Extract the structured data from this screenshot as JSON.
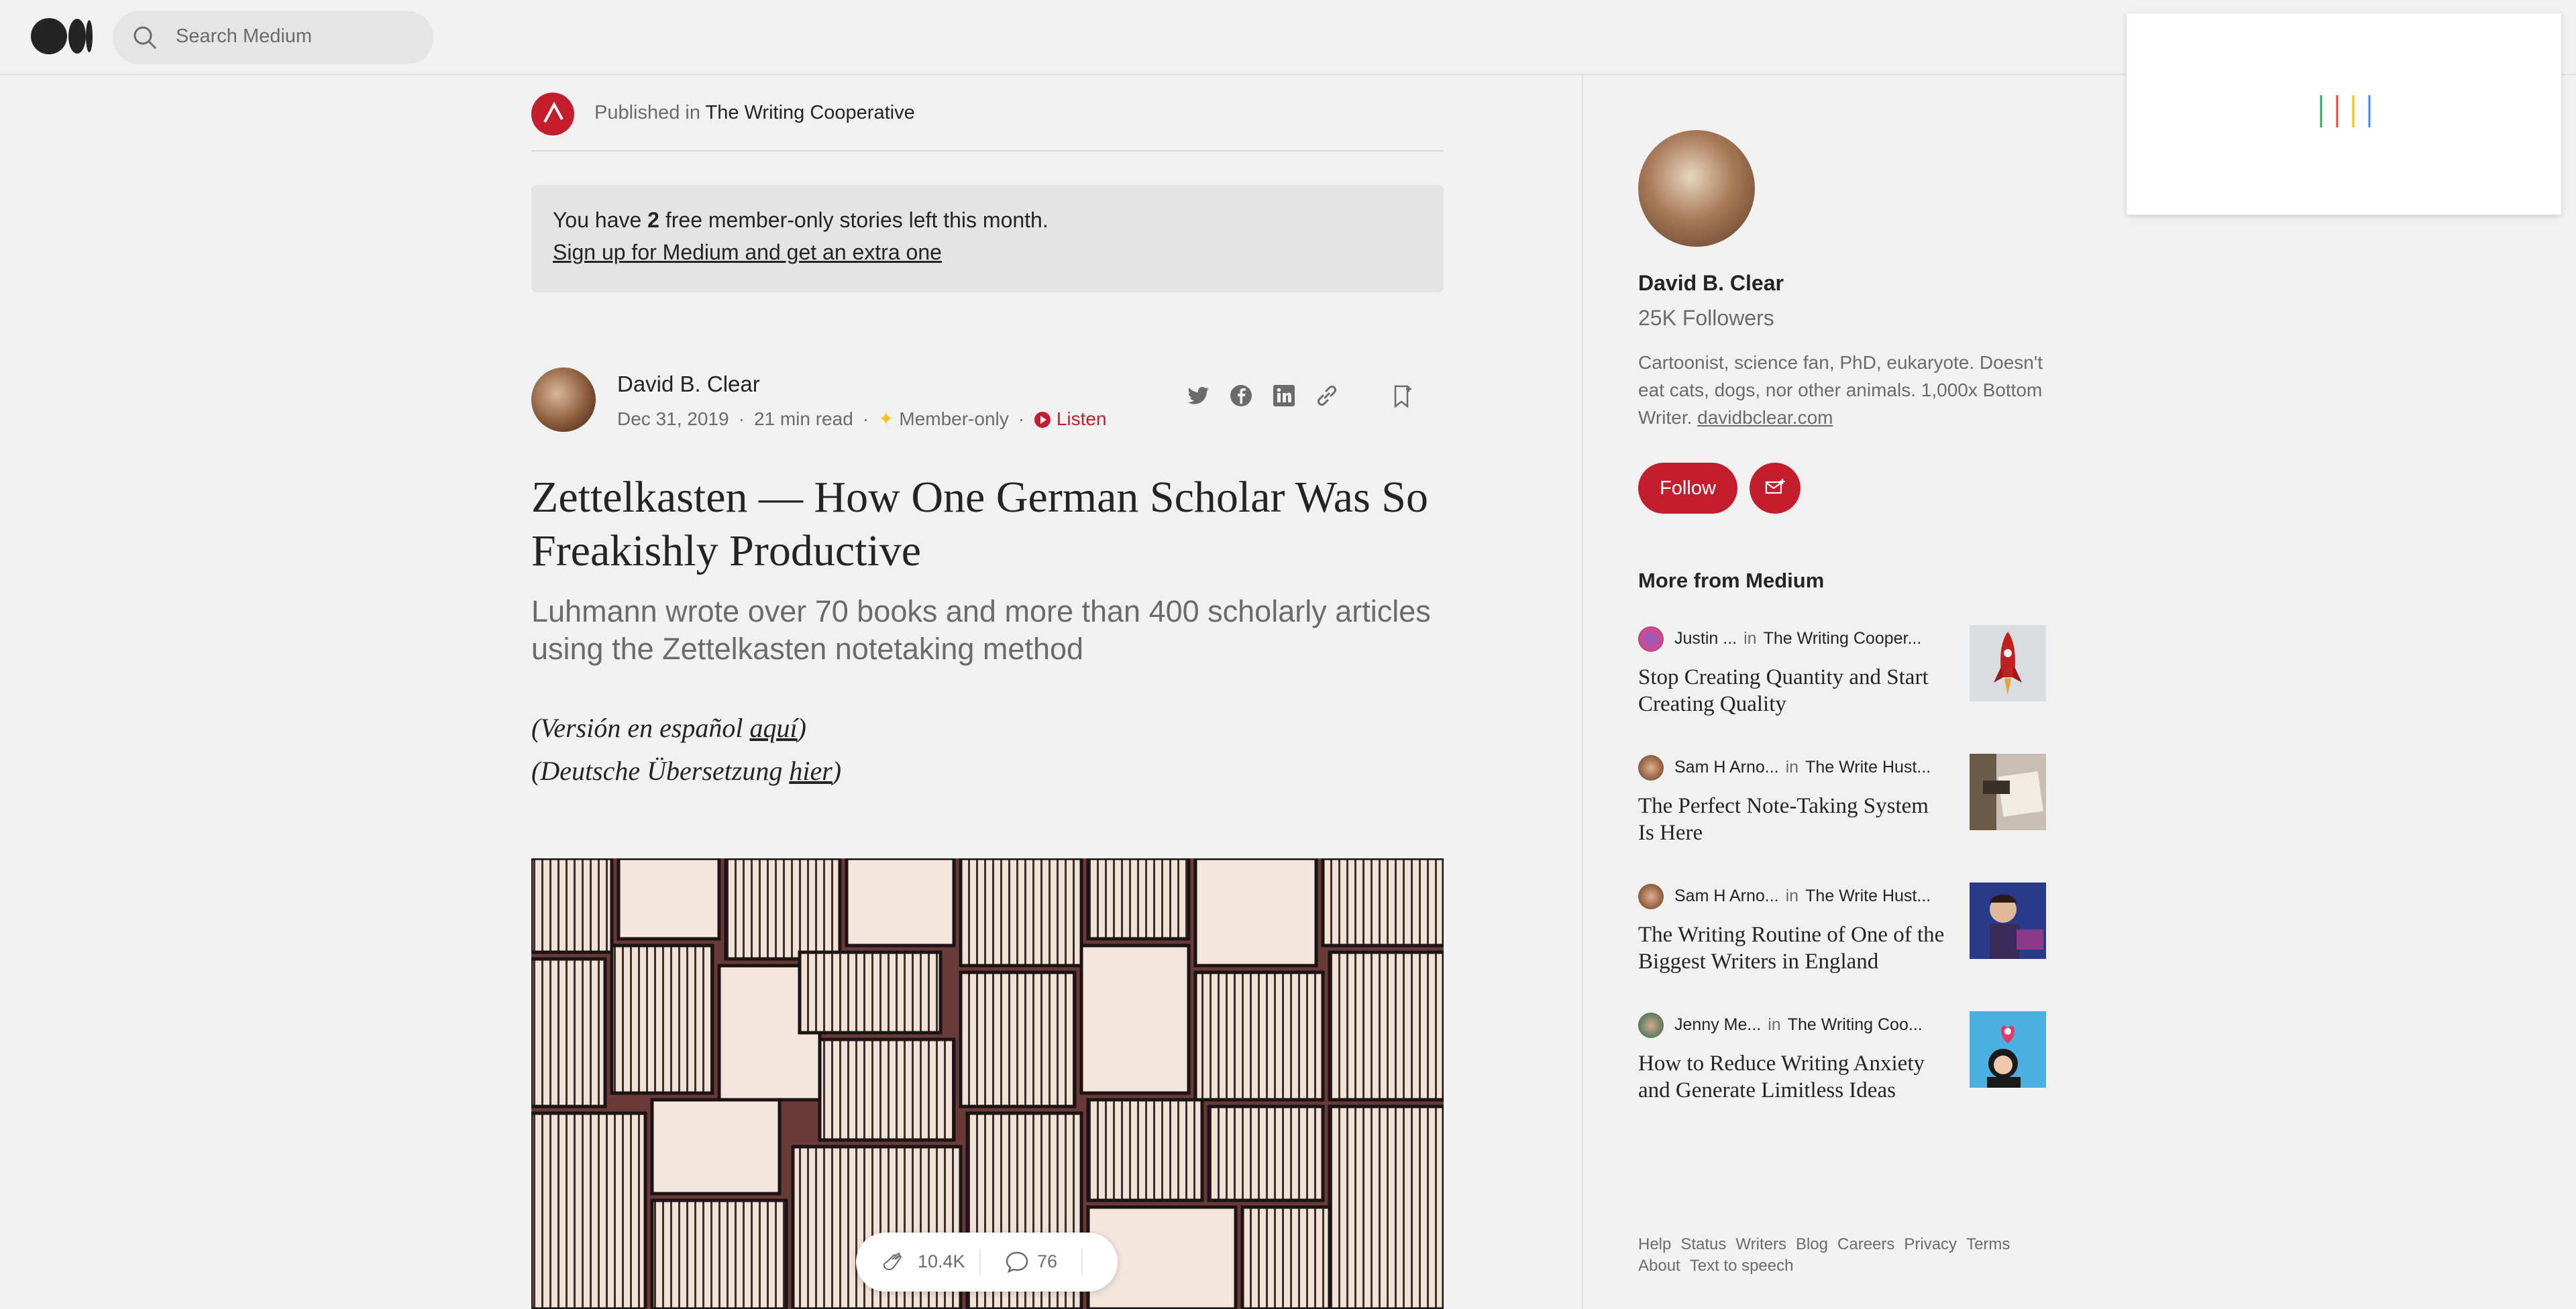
{
  "header": {
    "search_placeholder": "Search Medium"
  },
  "publication": {
    "prefix": "Published in",
    "name": "The Writing Cooperative"
  },
  "banner": {
    "line1_pre": "You have ",
    "count": "2",
    "line1_post": " free member-only stories left this month.",
    "signup_link": "Sign up for Medium and get an extra one"
  },
  "author": {
    "name": "David B. Clear",
    "date": "Dec 31, 2019",
    "read_time": "21 min read",
    "member_label": "Member-only",
    "listen_label": "Listen"
  },
  "article": {
    "title": "Zettelkasten — How One German Scholar Was So Freakishly Productive",
    "subtitle": "Luhmann wrote over 70 books and more than 400 scholarly articles using the Zettelkasten notetaking method",
    "translation_es_pre": "(Versión en español ",
    "translation_es_link": "aquí",
    "translation_es_post": ")",
    "translation_de_pre": "(Deutsche Übersetzung ",
    "translation_de_link": "hier",
    "translation_de_post": ")",
    "claps": "10.4K",
    "responses": "76"
  },
  "sidebar": {
    "name": "David B. Clear",
    "followers": "25K Followers",
    "bio": "Cartoonist, science fan, PhD, eukaryote. Doesn't eat cats, dogs, nor other animals. 1,000x Bottom Writer. ",
    "bio_link": "davidbclear.com",
    "follow_label": "Follow",
    "more_heading": "More from Medium",
    "recommendations": [
      {
        "author": "Justin ...",
        "in": "in",
        "publication": "The Writing Cooper...",
        "title": "Stop Creating Quantity and Start Creating Quality"
      },
      {
        "author": "Sam H Arno...",
        "in": "in",
        "publication": "The Write Hust...",
        "title": "The Perfect Note-Taking System Is Here"
      },
      {
        "author": "Sam H Arno...",
        "in": "in",
        "publication": "The Write Hust...",
        "title": "The Writing Routine of One of the Biggest Writers in England"
      },
      {
        "author": "Jenny Me...",
        "in": "in",
        "publication": "The Writing Coo...",
        "title": "How to Reduce Writing Anxiety and Generate Limitless Ideas"
      }
    ],
    "footer": [
      "Help",
      "Status",
      "Writers",
      "Blog",
      "Careers",
      "Privacy",
      "Terms",
      "About",
      "Text to speech"
    ]
  },
  "colors": {
    "accent": "#c41e2e",
    "background": "#f0f1f0",
    "text": "#242424",
    "muted": "#6b6b6b"
  }
}
